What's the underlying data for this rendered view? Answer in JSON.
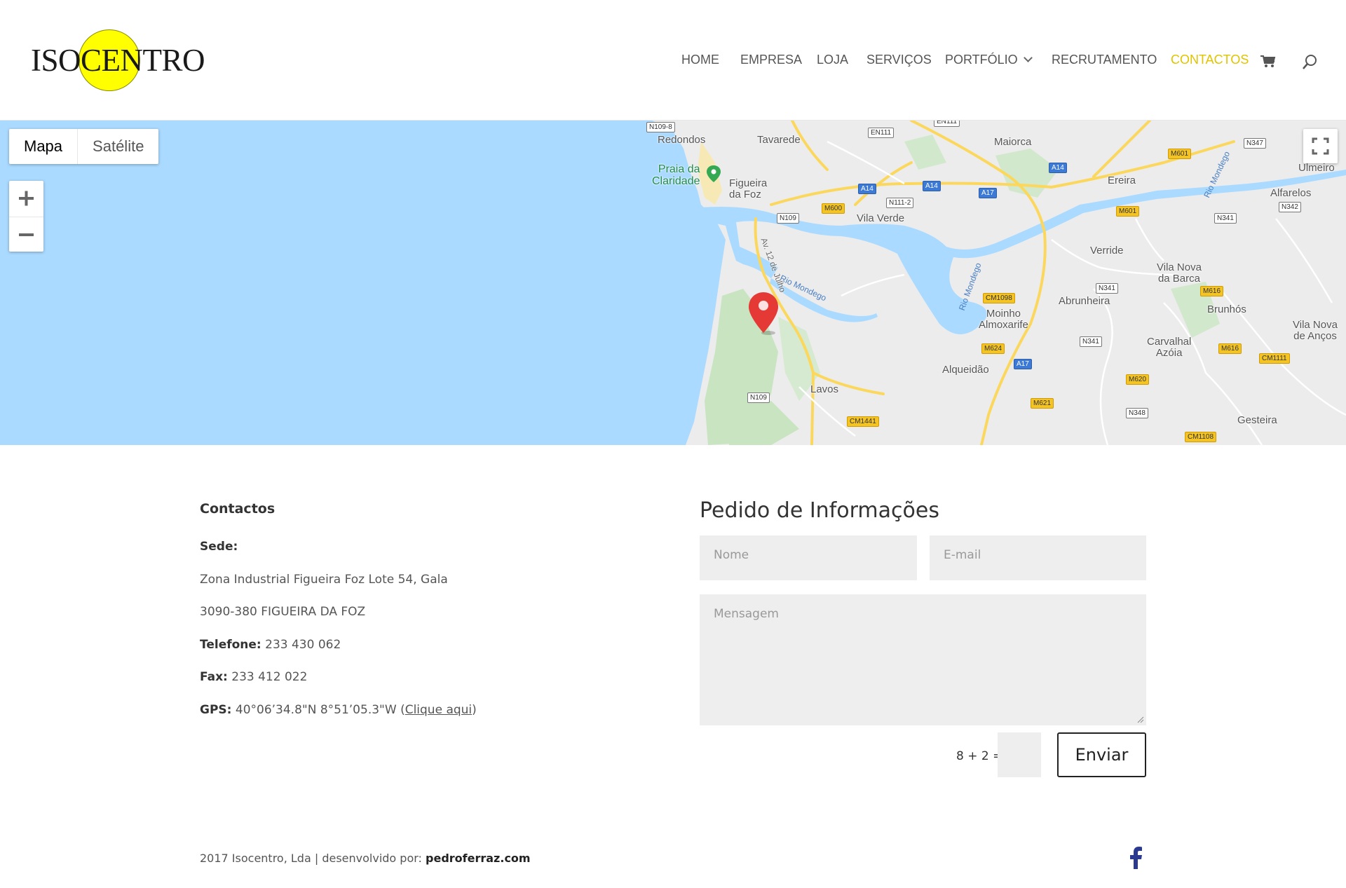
{
  "brand": {
    "logo_text": "ISOCENTRO"
  },
  "nav": {
    "items": [
      {
        "label": "HOME"
      },
      {
        "label": "EMPRESA"
      },
      {
        "label": "LOJA"
      },
      {
        "label": "SERVIÇOS"
      },
      {
        "label": "PORTFÓLIO"
      },
      {
        "label": "RECRUTAMENTO"
      },
      {
        "label": "CONTACTOS"
      }
    ],
    "active": "CONTACTOS",
    "accent_color": "#e0c400",
    "icons": [
      "chevron-down-icon",
      "cart-icon",
      "search-icon"
    ]
  },
  "map": {
    "type_buttons": {
      "map": "Mapa",
      "satellite": "Satélite"
    },
    "selected_type": "Mapa",
    "zoom_in": "+",
    "zoom_out": "−",
    "places": {
      "redondos": "Redondos",
      "tavarede": "Tavarede",
      "maiorca": "Maiorca",
      "praia": "Praia da\nClaridade",
      "figueira": "Figueira\nda Foz",
      "vila_verde": "Vila Verde",
      "ereira": "Ereira",
      "alfarelos": "Alfarelos",
      "ulmeiro": "Ulmeiro",
      "verride": "Verride",
      "vila_nova_barca": "Vila Nova\nda Barca",
      "abrunheira": "Abrunheira",
      "brunhos": "Brunhós",
      "moinho": "Moinho\nAlmoxarife",
      "vila_nova_ancos": "Vila Nova\nde Anços",
      "alqueidao": "Alqueidão",
      "carvalhal": "Carvalhal\nAzóia",
      "lavos": "Lavos",
      "gesteira": "Gesteira",
      "rio_mondego_1": "Rio Mondego",
      "rio_mondego_2": "Rio Mondego",
      "rio_mondego_3": "Rio Mondego",
      "avenida": "Av. 12 de Julho"
    },
    "roads": {
      "n109_8": "N109-8",
      "en111_a": "EN111",
      "en111_b": "EN111",
      "n347": "N347",
      "m601_a": "M601",
      "a14_a": "A14",
      "a14_b": "A14",
      "a14_c": "A14",
      "a17_a": "A17",
      "m600": "M600",
      "n111_2": "N111-2",
      "n109_a": "N109",
      "m601_b": "M601",
      "n342": "N342",
      "n341_a": "N341",
      "n341_b": "N341",
      "cm1098": "CM1098",
      "m616_a": "M616",
      "m624": "M624",
      "n341_c": "N341",
      "m616_b": "M616",
      "cm1111": "CM1111",
      "a17_b": "A17",
      "m620": "M620",
      "n109_b": "N109",
      "m621": "M621",
      "n348": "N348",
      "cm1441": "CM1441",
      "cm1108": "CM1108"
    }
  },
  "contacts": {
    "heading": "Contactos",
    "sede_label": "Sede:",
    "address1": "Zona Industrial Figueira Foz Lote 54, Gala",
    "address2": "3090-380 FIGUEIRA DA FOZ",
    "phone_label": "Telefone:",
    "phone": "233 430 062",
    "fax_label": "Fax:",
    "fax": "233 412 022",
    "gps_label": "GPS:",
    "gps": "40°06’34.8\"N 8°51’05.3\"W (",
    "gps_link": "Clique aqui",
    "gps_close": ")"
  },
  "form": {
    "title": "Pedido de Informações",
    "name_placeholder": "Nome",
    "email_placeholder": "E-mail",
    "message_placeholder": "Mensagem",
    "captcha": "8 + 2 =",
    "submit": "Enviar"
  },
  "footer": {
    "text": "2017 Isocentro, Lda | desenvolvido por: ",
    "credit": "pedroferraz.com",
    "social": "facebook-icon"
  }
}
